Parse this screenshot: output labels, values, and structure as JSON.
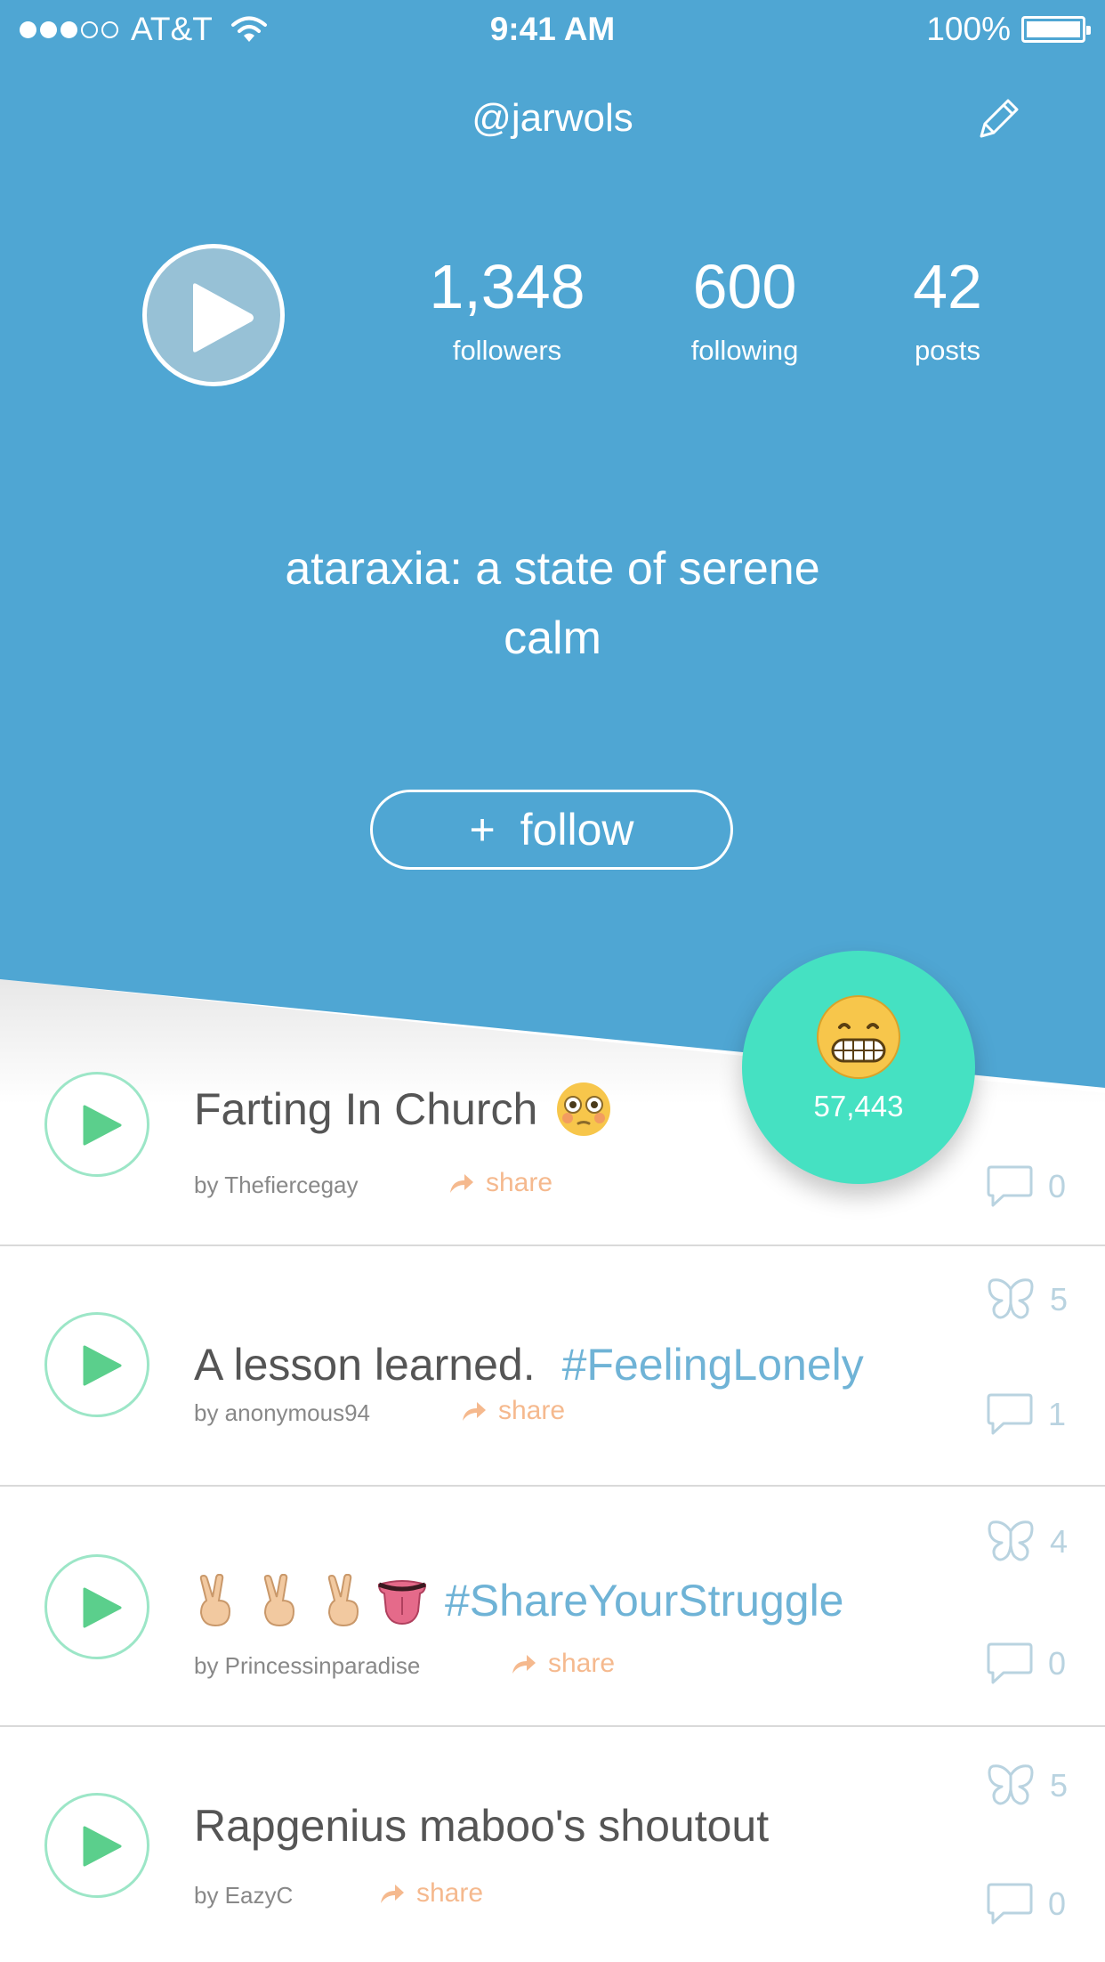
{
  "status_bar": {
    "carrier": "AT&T",
    "time": "9:41 AM",
    "battery": "100%"
  },
  "profile": {
    "username": "@jarwols",
    "stats": [
      {
        "value": "1,348",
        "label": "followers"
      },
      {
        "value": "600",
        "label": "following"
      },
      {
        "value": "42",
        "label": "posts"
      }
    ],
    "bio_line1": "ataraxia: a state of serene",
    "bio_line2": "calm",
    "follow_plus": "+",
    "follow_label": "follow"
  },
  "fab": {
    "emoji": "grimacing-face",
    "count": "57,443"
  },
  "feed": [
    {
      "title": "Farting In Church",
      "emoji": "flushed-face",
      "author": "by Thefiercegay",
      "share": "share",
      "comments": "0"
    },
    {
      "title": "A lesson learned.",
      "hashtag": "#FeelingLonely",
      "author": "by anonymous94",
      "share": "share",
      "likes": "5",
      "comments": "1"
    },
    {
      "emoji_group": [
        "victory-hand",
        "victory-hand",
        "victory-hand",
        "tongue"
      ],
      "hashtag": "#ShareYourStruggle",
      "author": "by Princessinparadise",
      "share": "share",
      "likes": "4",
      "comments": "0"
    },
    {
      "title": "Rapgenius maboo's shoutout",
      "author": "by EazyC",
      "share": "share",
      "likes": "5",
      "comments": "0"
    }
  ],
  "colors": {
    "header": "#4fa6d3",
    "fab": "#45e1c2",
    "play_green": "#5bcf8c",
    "share": "#f5b98e",
    "hashtag": "#6fb3d6"
  }
}
